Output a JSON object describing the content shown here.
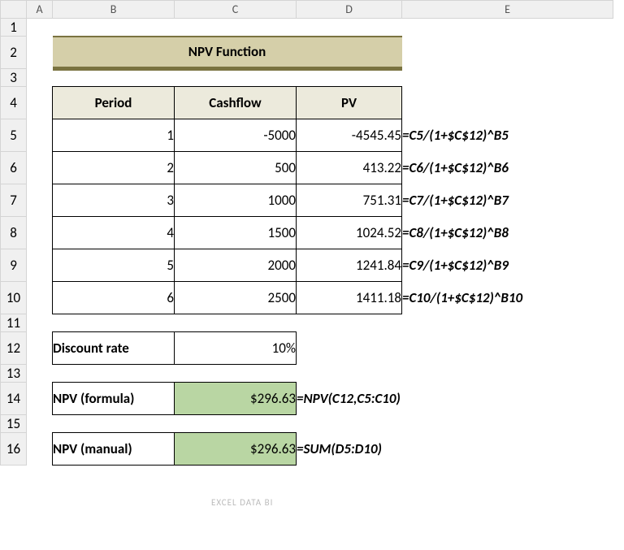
{
  "columns": {
    "A": "A",
    "B": "B",
    "C": "C",
    "D": "D",
    "E": "E"
  },
  "rows": [
    "1",
    "2",
    "3",
    "4",
    "5",
    "6",
    "7",
    "8",
    "9",
    "10",
    "11",
    "12",
    "13",
    "14",
    "15",
    "16"
  ],
  "title": "NPV Function",
  "headers": {
    "period": "Period",
    "cashflow": "Cashflow",
    "pv": "PV"
  },
  "data": [
    {
      "period": "1",
      "cashflow": "-5000",
      "pv": "-4545.45",
      "formula": "=C5/(1+$C$12)^B5"
    },
    {
      "period": "2",
      "cashflow": "500",
      "pv": "413.22",
      "formula": "=C6/(1+$C$12)^B6"
    },
    {
      "period": "3",
      "cashflow": "1000",
      "pv": "751.31",
      "formula": "=C7/(1+$C$12)^B7"
    },
    {
      "period": "4",
      "cashflow": "1500",
      "pv": "1024.52",
      "formula": "=C8/(1+$C$12)^B8"
    },
    {
      "period": "5",
      "cashflow": "2000",
      "pv": "1241.84",
      "formula": "=C9/(1+$C$12)^B9"
    },
    {
      "period": "6",
      "cashflow": "2500",
      "pv": "1411.18",
      "formula": "=C10/(1+$C$12)^B10"
    }
  ],
  "discount": {
    "label": "Discount rate",
    "value": "10%"
  },
  "npv_formula": {
    "label": "NPV (formula)",
    "value": "$296.63",
    "formula": "=NPV(C12,C5:C10)"
  },
  "npv_manual": {
    "label": "NPV (manual)",
    "value": "$296.63",
    "formula": "=SUM(D5:D10)"
  },
  "watermark": "EXCEL DATA BI",
  "chart_data": {
    "type": "table",
    "title": "NPV Function",
    "columns": [
      "Period",
      "Cashflow",
      "PV"
    ],
    "rows": [
      [
        1,
        -5000,
        -4545.45
      ],
      [
        2,
        500,
        413.22
      ],
      [
        3,
        1000,
        751.31
      ],
      [
        4,
        1500,
        1024.52
      ],
      [
        5,
        2000,
        1241.84
      ],
      [
        6,
        2500,
        1411.18
      ]
    ],
    "parameters": {
      "discount_rate": 0.1
    },
    "results": {
      "npv_formula": 296.63,
      "npv_manual": 296.63
    }
  }
}
